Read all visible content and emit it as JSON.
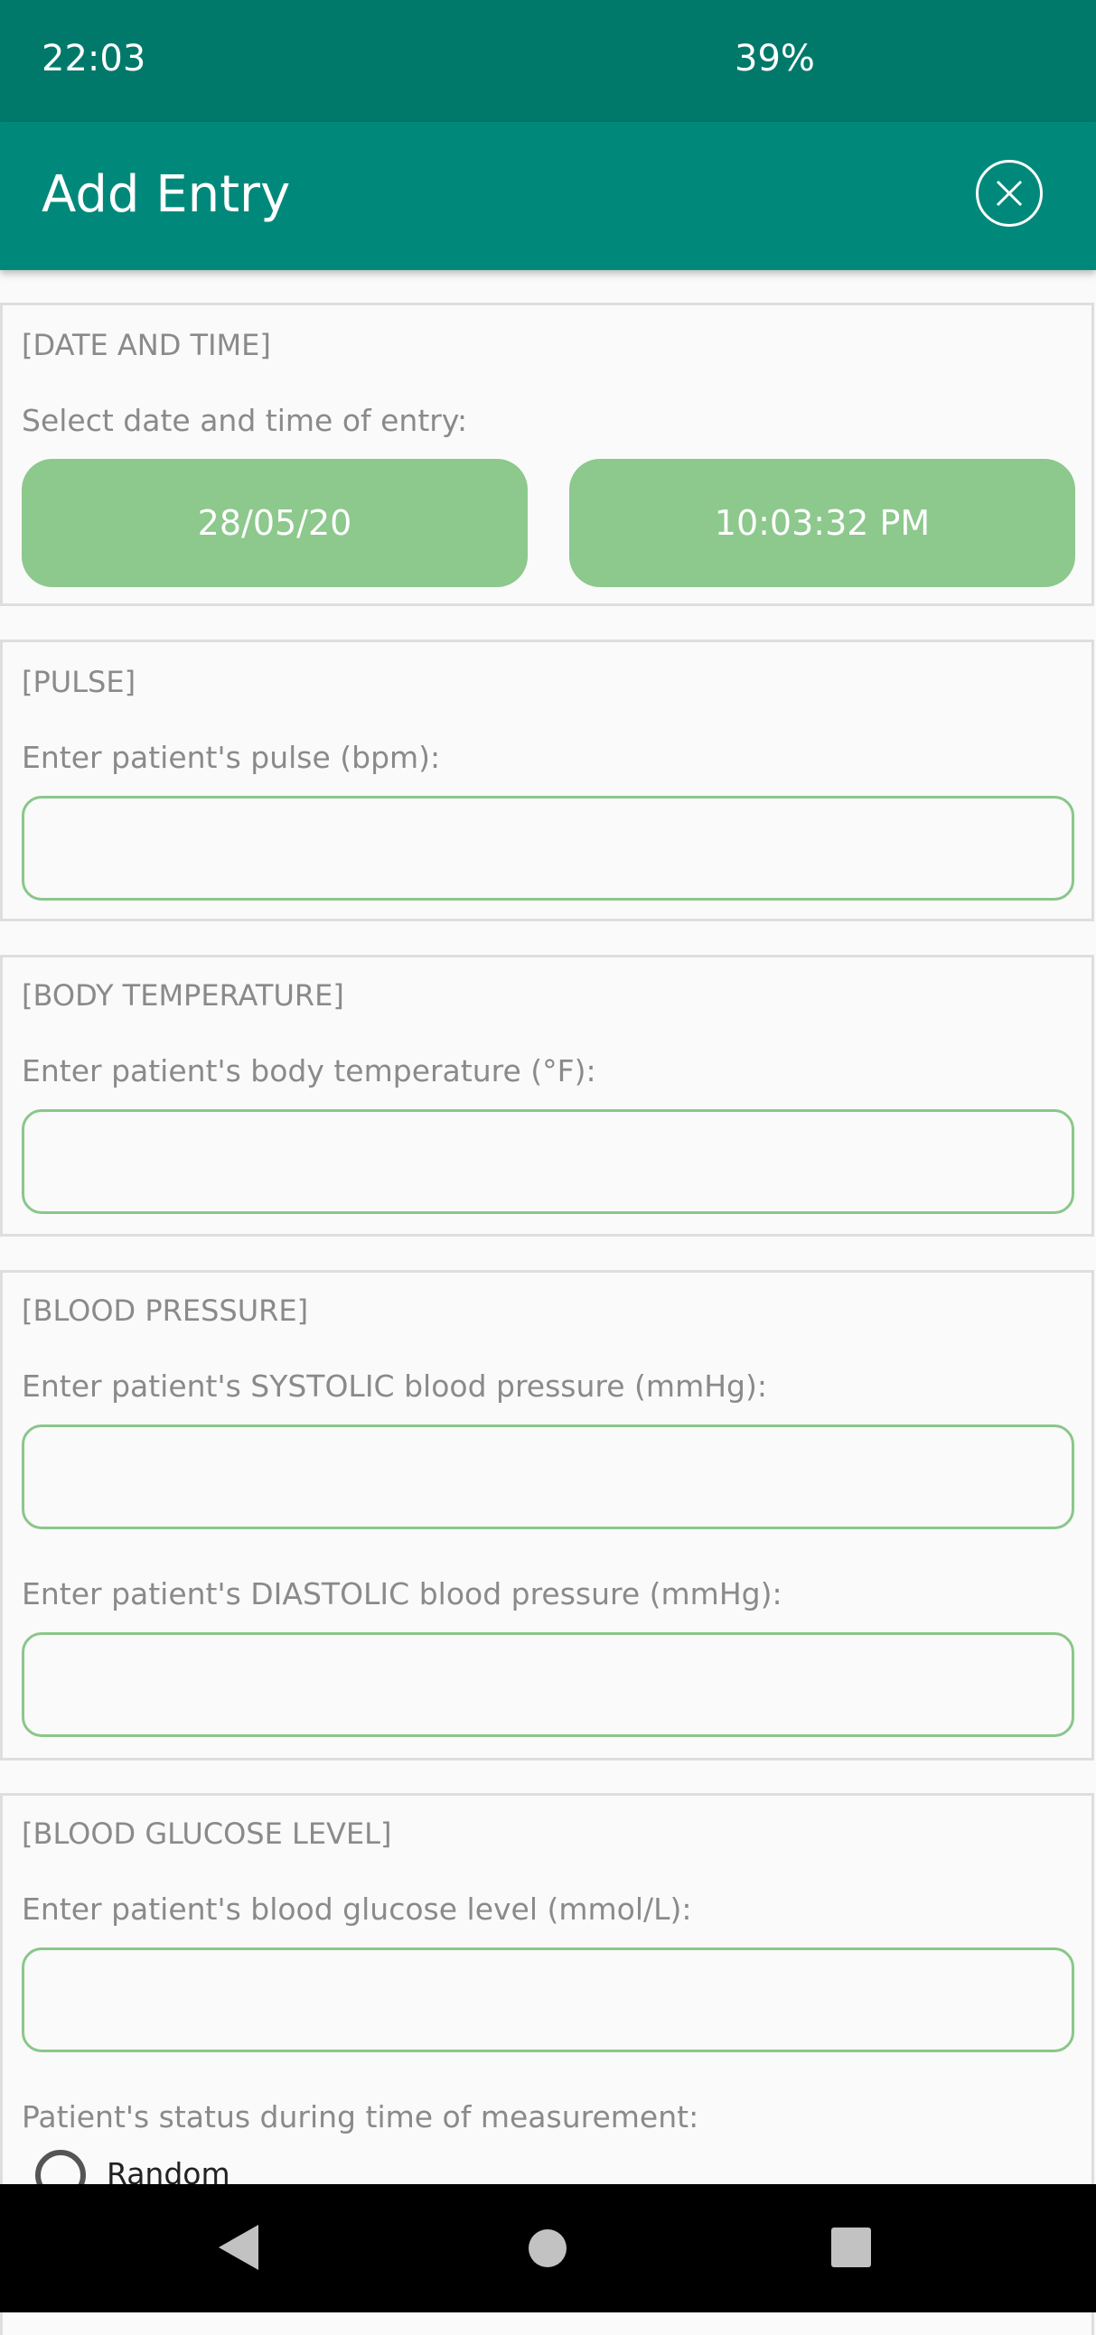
{
  "status_bar": {
    "time": "22:03",
    "battery": "39%"
  },
  "app_bar": {
    "title": "Add Entry",
    "close_icon": "close-circle-icon"
  },
  "date_time": {
    "title": "[DATE AND TIME]",
    "label": "Select date and time of entry:",
    "date_value": "28/05/20",
    "time_value": "10:03:32 PM"
  },
  "pulse": {
    "title": "[PULSE]",
    "label": "Enter patient's pulse (bpm):",
    "value": ""
  },
  "body_temperature": {
    "title": "[BODY TEMPERATURE]",
    "label": "Enter patient's body temperature (°F):",
    "value": ""
  },
  "blood_pressure": {
    "title": "[BLOOD PRESSURE]",
    "systolic_label": "Enter patient's SYSTOLIC blood pressure (mmHg):",
    "systolic_value": "",
    "diastolic_label": "Enter patient's DIASTOLIC blood pressure (mmHg):",
    "diastolic_value": ""
  },
  "blood_glucose": {
    "title": "[BLOOD GLUCOSE LEVEL]",
    "label": "Enter patient's blood glucose level (mmol/L):",
    "value": "",
    "status_label": "Patient's status during time of measurement:",
    "status_options": [
      {
        "label": "Random",
        "selected": false
      }
    ]
  },
  "colors": {
    "status_bar": "#00796b",
    "app_bar": "#00897b",
    "button_green": "#8dc88d",
    "input_border": "#8ac78a"
  },
  "nav_bar": {
    "back_icon": "back-triangle-icon",
    "home_icon": "home-circle-icon",
    "recents_icon": "recents-square-icon"
  }
}
